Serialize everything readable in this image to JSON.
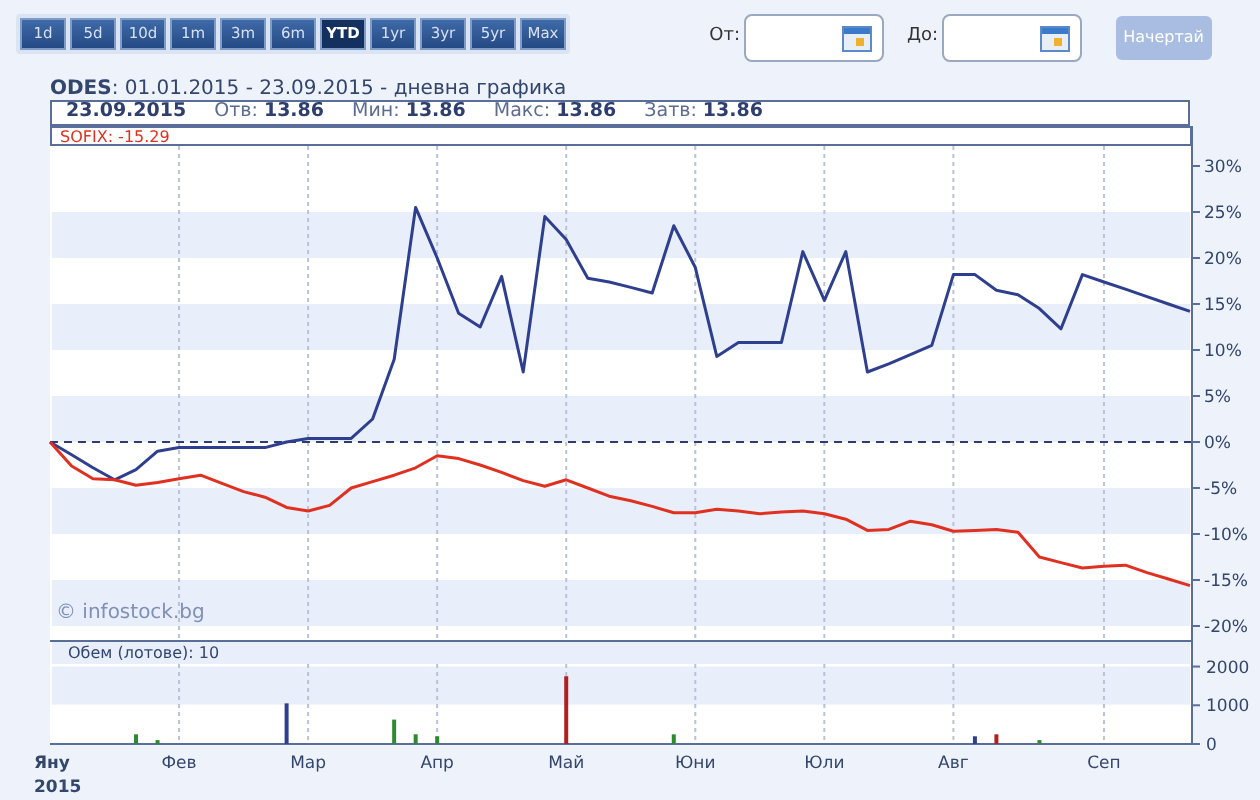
{
  "range_buttons": [
    {
      "label": "1d",
      "selected": false
    },
    {
      "label": "5d",
      "selected": false
    },
    {
      "label": "10d",
      "selected": false
    },
    {
      "label": "1m",
      "selected": false
    },
    {
      "label": "3m",
      "selected": false
    },
    {
      "label": "6m",
      "selected": false
    },
    {
      "label": "YTD",
      "selected": true
    },
    {
      "label": "1yr",
      "selected": false
    },
    {
      "label": "3yr",
      "selected": false
    },
    {
      "label": "5yr",
      "selected": false
    },
    {
      "label": "Max",
      "selected": false
    }
  ],
  "date_from": {
    "label": "От:"
  },
  "date_to": {
    "label": "До:"
  },
  "draw_button": {
    "label": "Начертай",
    "disabled": true
  },
  "chart": {
    "subtitle": ": 01.01.2015 - 23.09.2015 - дневна графика",
    "summary": {
      "date": "23.09.2015",
      "fields": [
        {
          "label": "Отв:",
          "value": "13.86"
        },
        {
          "label": "Мин:",
          "value": "13.86"
        },
        {
          "label": "Макс:",
          "value": "13.86"
        },
        {
          "label": "Затв:",
          "value": "13.86"
        }
      ]
    },
    "legend_value": ": -15.29",
    "credit": "© infostock.bg",
    "price_chart": {
      "chart_data": {
        "type": "line",
        "grid": true,
        "ref_lines": [
          {
            "axis": "y",
            "value": 0
          }
        ],
        "ylim": [
          -20,
          32
        ],
        "categories": [
          null,
          null,
          null,
          null,
          null,
          null,
          null,
          null,
          null,
          null,
          null,
          null,
          null,
          null,
          null,
          null,
          null,
          null,
          null,
          null,
          null,
          null,
          null,
          null,
          null,
          null,
          null,
          null,
          null,
          null,
          null,
          null,
          null,
          null,
          null,
          null,
          null,
          null,
          null,
          null,
          null,
          null,
          null,
          null,
          null,
          null,
          null,
          null,
          null,
          null,
          null,
          null,
          null,
          null
        ],
        "yticks": [
          {
            "value": -20,
            "label": "-20%"
          },
          {
            "value": -15,
            "label": "-15%"
          },
          {
            "value": -10,
            "label": "-10%"
          },
          {
            "value": -5,
            "label": "-5%"
          },
          {
            "value": 0,
            "label": "0%"
          },
          {
            "value": 5,
            "label": "5%"
          },
          {
            "value": 10,
            "label": "10%"
          },
          {
            "value": 15,
            "label": "15%"
          },
          {
            "value": 20,
            "label": "20%"
          },
          {
            "value": 25,
            "label": "25%"
          },
          {
            "value": 30,
            "label": "30%"
          }
        ],
        "series": [
          {
            "name": "ODES",
            "color": "#2e3f8f",
            "values": [
              0,
              -1.4,
              -2.8,
              -4.1,
              -3,
              -1,
              -0.6,
              -0.6,
              -0.6,
              -0.6,
              -0.6,
              0,
              0.4,
              0.4,
              0.4,
              2.5,
              9,
              25.5,
              20,
              14,
              12.5,
              18,
              7.6,
              24.5,
              22,
              17.8,
              17.4,
              16.8,
              16.2,
              23.5,
              19,
              9.3,
              10.8,
              10.8,
              10.8,
              20.7,
              15.4,
              20.7,
              7.6,
              8.5,
              9.5,
              10.5,
              18.2,
              18.2,
              16.5,
              16,
              14.5,
              12.3,
              18.2,
              17.4,
              16.6,
              15.8,
              15,
              14.2
            ]
          },
          {
            "name": "SOFIX",
            "color": "#e03020",
            "values": [
              0,
              -2.6,
              -4,
              -4.1,
              -4.7,
              -4.4,
              -4,
              -3.6,
              -4.5,
              -5.4,
              -6,
              -7.1,
              -7.5,
              -6.9,
              -5,
              -4.3,
              -3.6,
              -2.8,
              -1.5,
              -1.8,
              -2.5,
              -3.3,
              -4.2,
              -4.8,
              -4.1,
              -5,
              -5.9,
              -6.4,
              -7,
              -7.7,
              -7.7,
              -7.3,
              -7.5,
              -7.8,
              -7.6,
              -7.5,
              -7.8,
              -8.4,
              -9.6,
              -9.5,
              -8.6,
              -9,
              -9.7,
              -9.6,
              -9.5,
              -9.8,
              -12.5,
              -13.1,
              -13.7,
              -13.5,
              -13.4,
              -14.2,
              -14.9,
              -15.6
            ]
          }
        ]
      }
    },
    "volume_label": "Обем (лотове): 10",
    "volume_chart": {
      "chart_data": {
        "type": "bar",
        "grid": true,
        "stacked": true,
        "ylim": [
          0,
          2500
        ],
        "categories": [
          "Яну",
          null,
          null,
          null,
          null,
          null,
          "Фев",
          null,
          null,
          null,
          null,
          null,
          "Мар",
          null,
          null,
          null,
          null,
          null,
          "Апр",
          null,
          null,
          null,
          null,
          null,
          "Май",
          null,
          null,
          null,
          null,
          null,
          "Юни",
          null,
          null,
          null,
          null,
          null,
          "Юли",
          null,
          null,
          null,
          null,
          null,
          "Авг",
          null,
          null,
          null,
          null,
          null,
          null,
          "Сеп",
          null,
          null,
          null,
          null
        ],
        "yticks": [
          0,
          1000,
          2000
        ],
        "series": [
          {
            "color": "#2e8a2e",
            "values": [
              null,
              null,
              null,
              null,
              250,
              100,
              null,
              null,
              null,
              null,
              null,
              null,
              null,
              null,
              null,
              null,
              630,
              250,
              200,
              null,
              null,
              null,
              null,
              null,
              null,
              null,
              null,
              null,
              null,
              250,
              null,
              null,
              null,
              null,
              null,
              null,
              null,
              null,
              null,
              null,
              null,
              null,
              null,
              null,
              null,
              null,
              100,
              null,
              null,
              null,
              null,
              null,
              null,
              null
            ]
          },
          {
            "color": "#b02020",
            "values": [
              null,
              null,
              null,
              null,
              null,
              null,
              null,
              null,
              null,
              null,
              null,
              null,
              null,
              null,
              null,
              null,
              null,
              null,
              null,
              null,
              null,
              null,
              null,
              null,
              1750,
              null,
              null,
              null,
              null,
              null,
              null,
              null,
              null,
              null,
              null,
              null,
              null,
              null,
              null,
              null,
              null,
              null,
              null,
              null,
              250,
              null,
              null,
              null,
              null,
              null,
              null,
              null,
              null,
              null
            ]
          },
          {
            "color": "#2e3f8f",
            "values": [
              null,
              null,
              null,
              null,
              null,
              null,
              null,
              null,
              null,
              null,
              null,
              1050,
              null,
              null,
              null,
              null,
              null,
              null,
              null,
              null,
              null,
              null,
              null,
              null,
              null,
              null,
              null,
              null,
              null,
              null,
              null,
              null,
              null,
              null,
              null,
              null,
              null,
              null,
              null,
              null,
              null,
              null,
              null,
              200,
              null,
              null,
              null,
              null,
              null,
              null,
              null,
              null,
              null,
              null
            ]
          }
        ]
      }
    },
    "year": "2015"
  }
}
